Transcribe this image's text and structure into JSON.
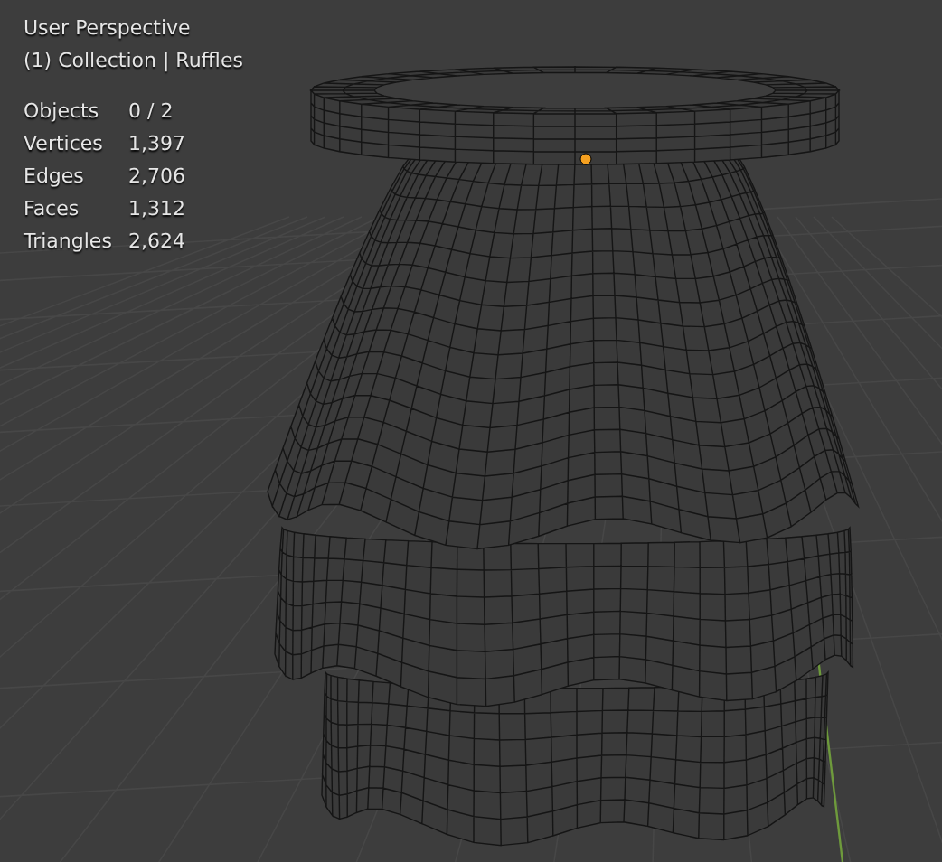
{
  "viewport": {
    "view_name": "User Perspective",
    "collection": "(1) Collection | Ruffles"
  },
  "stats": [
    {
      "label": "Objects",
      "value": "0 / 2"
    },
    {
      "label": "Vertices",
      "value": "1,397"
    },
    {
      "label": "Edges",
      "value": "2,706"
    },
    {
      "label": "Faces",
      "value": "1,312"
    },
    {
      "label": "Triangles",
      "value": "2,624"
    }
  ]
}
